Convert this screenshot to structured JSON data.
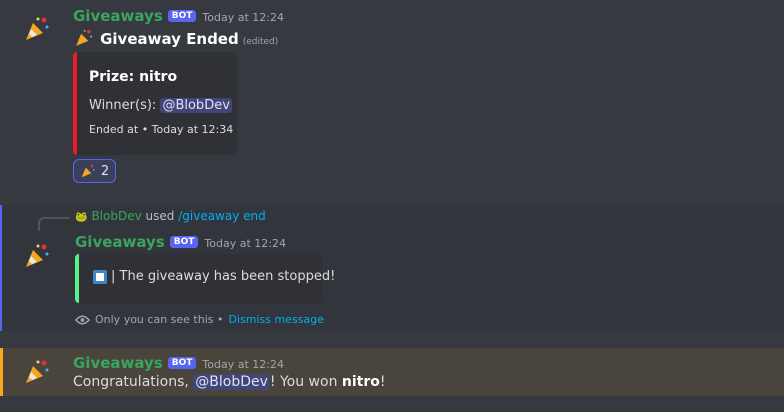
{
  "colors": {
    "background": "#36393f",
    "username": "#3ba55d",
    "bot_tag": "#5865f2",
    "embed_red": "#ed1c24",
    "embed_green": "#57f287",
    "link": "#00aff4",
    "mention_highlight": "#faa81a"
  },
  "msg1": {
    "username": "Giveaways",
    "bot_tag": "BOT",
    "timestamp": "Today at 12:24",
    "avatar_icon": "party-popper-icon",
    "title_icon": "party-popper-icon",
    "title": "Giveaway Ended",
    "edited": "(edited)",
    "embed": {
      "prize": "Prize: nitro",
      "winner_label": "Winner(s):",
      "winner_mention": "@BlobDev",
      "ended_at": "Ended at • Today at 12:34"
    },
    "reaction": {
      "icon": "party-popper-icon",
      "count": "2"
    }
  },
  "msg2": {
    "command_user": "BlobDev",
    "command_used": "used",
    "command": "/giveaway end",
    "username": "Giveaways",
    "bot_tag": "BOT",
    "timestamp": "Today at 12:24",
    "embed_text": "| The giveaway has been stopped!",
    "ephemeral_text": "Only you can see this •",
    "dismiss": "Dismiss message"
  },
  "msg3": {
    "username": "Giveaways",
    "bot_tag": "BOT",
    "timestamp": "Today at 12:24",
    "text_before": "Congratulations,",
    "mention": "@BlobDev",
    "text_middle": "! You won",
    "prize": "nitro",
    "text_end": "!"
  }
}
